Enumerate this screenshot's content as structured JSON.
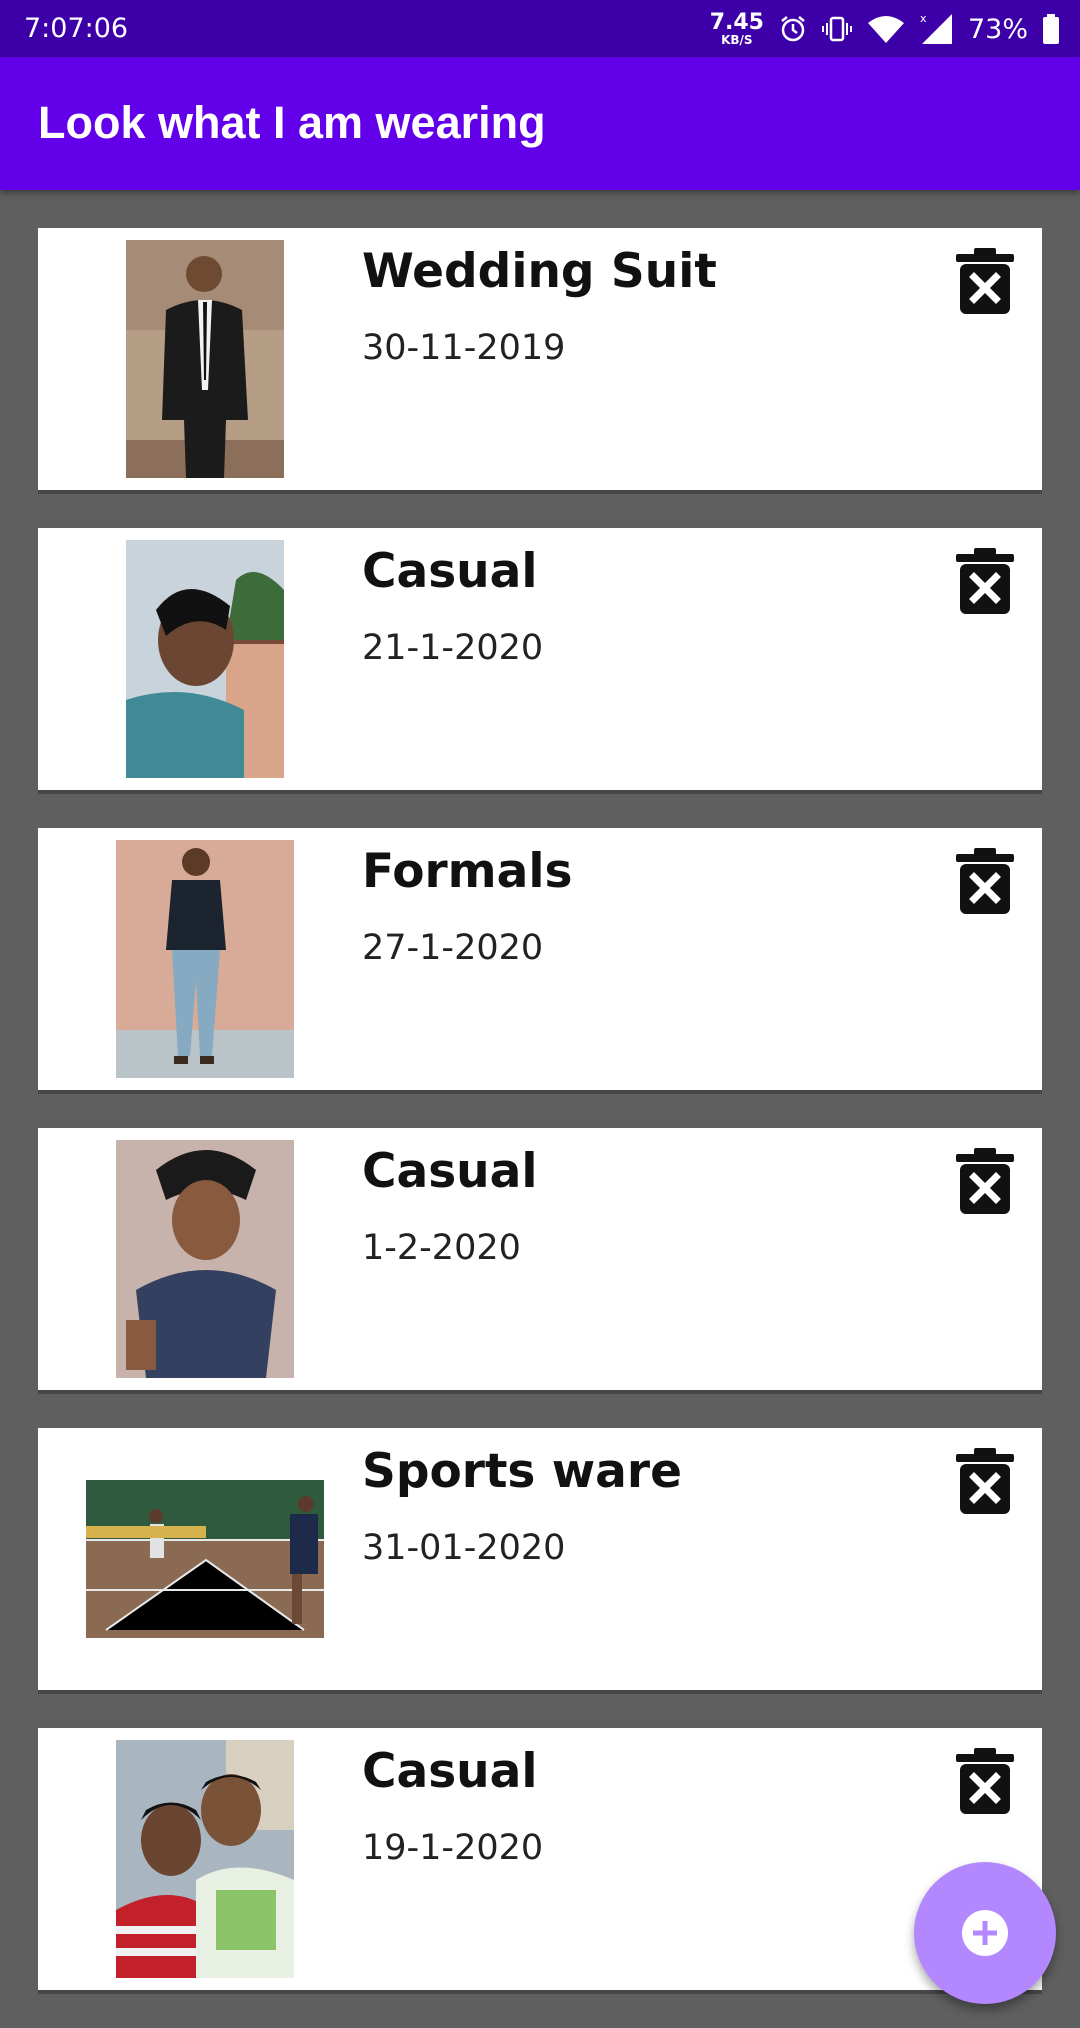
{
  "status_bar": {
    "time": "7:07:06",
    "net_speed_value": "7.45",
    "net_speed_unit": "KB/S",
    "battery_percent": "73%",
    "icons": [
      "alarm-icon",
      "vibrate-icon",
      "wifi-icon",
      "signal-icon",
      "battery-icon"
    ]
  },
  "app_bar": {
    "title": "Look what I am wearing",
    "color": "#6200ea"
  },
  "outfits": [
    {
      "name": "Wedding Suit",
      "date": "30-11-2019",
      "photo": "man-in-black-suit-photo"
    },
    {
      "name": "Casual",
      "date": "21-1-2020",
      "photo": "man-side-profile-photo"
    },
    {
      "name": "Formals",
      "date": "27-1-2020",
      "photo": "man-standing-by-wall-photo"
    },
    {
      "name": "Casual",
      "date": "1-2-2020",
      "photo": "selfie-photo"
    },
    {
      "name": "Sports ware",
      "date": "31-01-2020",
      "photo": "badminton-court-photo"
    },
    {
      "name": "Casual",
      "date": "19-1-2020",
      "photo": "two-friends-photo"
    }
  ],
  "icons": {
    "delete": "delete-forever-icon",
    "fab": "add-circle-icon"
  },
  "colors": {
    "status_bar": "#3d00a8",
    "background": "#5f5f5f",
    "fab": "#b388ff"
  }
}
